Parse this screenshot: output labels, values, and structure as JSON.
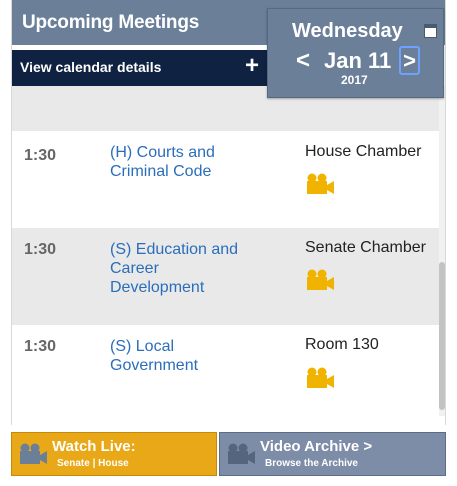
{
  "header": {
    "title": "Upcoming Meetings",
    "calendar_link": "View calendar details",
    "calendar_plus": "+"
  },
  "date_nav": {
    "weekday": "Wednesday",
    "prev": "<",
    "date": "Jan 11",
    "next": ">",
    "year": "2017"
  },
  "meetings": [
    {
      "time": "1:30",
      "name": "(H) Courts and Criminal Code",
      "room": "House Chamber"
    },
    {
      "time": "1:30",
      "name": "(S) Education and Career Development",
      "room": "Senate Chamber"
    },
    {
      "time": "1:30",
      "name": "(S) Local Government",
      "room": "Room 130"
    }
  ],
  "buttons": {
    "watch_live": {
      "title": "Watch Live:",
      "subtitle": "Senate | House"
    },
    "video_archive": {
      "title": "Video Archive >",
      "subtitle": "Browse the Archive"
    }
  },
  "colors": {
    "header_bg": "#6b7f99",
    "calendar_bar_bg": "#0f2241",
    "link": "#2a6ebb",
    "camera_icon": "#f0b400",
    "watch_live_bg": "#e8a817",
    "archive_bg": "#7d8da7"
  },
  "icons": {
    "camera": "video-camera-icon",
    "calendar": "calendar-icon"
  }
}
